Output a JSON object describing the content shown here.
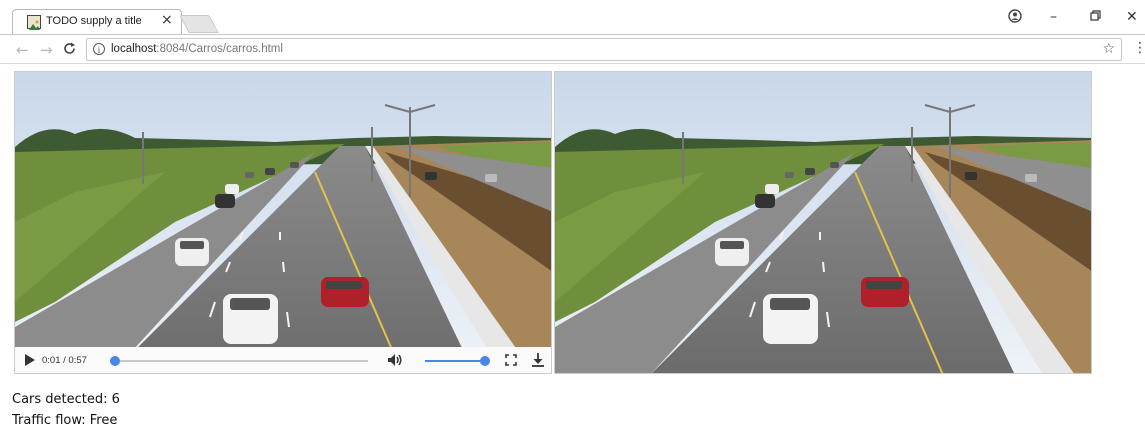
{
  "browser": {
    "tab_title": "TODO supply a title",
    "url_host": "localhost",
    "url_rest": ":8084/Carros/carros.html"
  },
  "icons": {
    "favicon": "image-icon",
    "tab_close": "close-icon",
    "back": "back-arrow-icon",
    "forward": "forward-arrow-icon",
    "reload": "reload-icon",
    "site_info": "info-icon",
    "bookmark": "star-icon",
    "menu": "three-dots-icon",
    "play": "play-icon",
    "volume": "volume-icon",
    "fullscreen": "fullscreen-icon",
    "download": "download-icon"
  },
  "video_player": {
    "time_display": "0:01 / 0:57",
    "progress_fraction": 0.0175,
    "volume_fraction": 1.0,
    "accent_color": "#4a86e8"
  },
  "stats": {
    "cars_detected": "Cars detected: 6",
    "traffic_flow": "Traffic flow: Free"
  }
}
